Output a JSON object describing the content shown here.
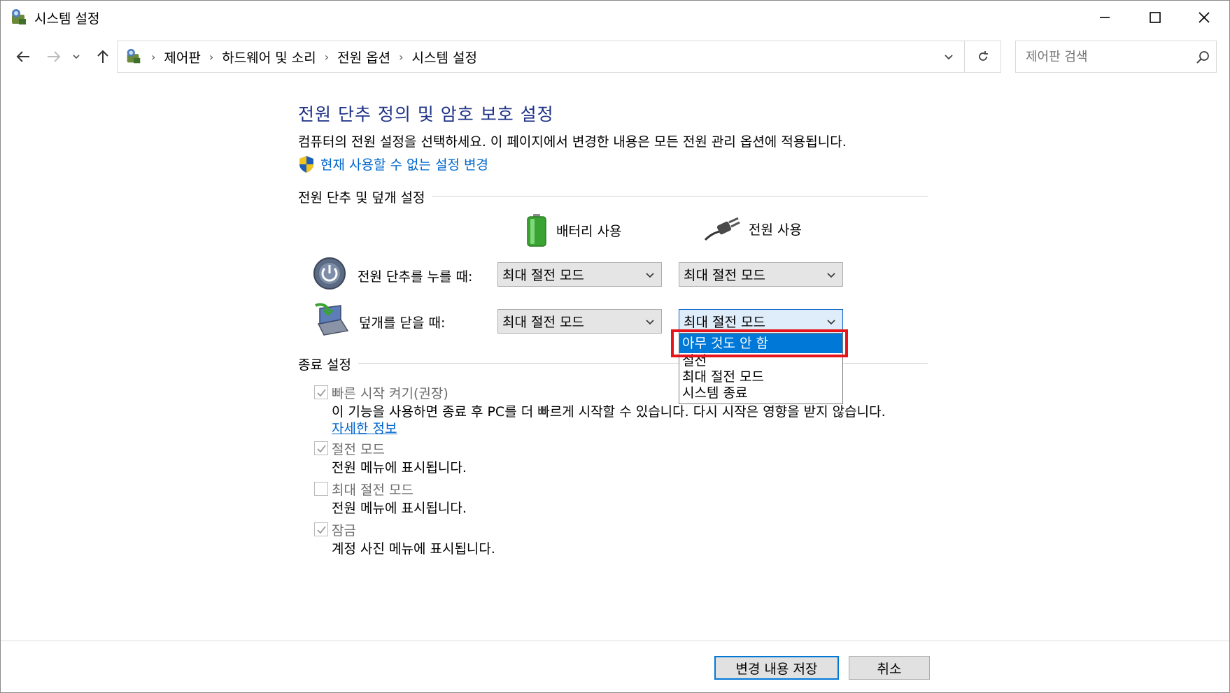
{
  "window": {
    "title": "시스템 설정",
    "controls": [
      "minimize",
      "maximize",
      "close"
    ]
  },
  "address": {
    "breadcrumbs": [
      "제어판",
      "하드웨어 및 소리",
      "전원 옵션",
      "시스템 설정"
    ],
    "search_placeholder": "제어판 검색"
  },
  "page": {
    "heading": "전원 단추 정의 및 암호 보호 설정",
    "description": "컴퓨터의 전원 설정을 선택하세요. 이 페이지에서 변경한 내용은 모든 전원 관리 옵션에 적용됩니다.",
    "admin_link": "현재 사용할 수 없는 설정 변경"
  },
  "power_section": {
    "title": "전원 단추 및 덮개 설정",
    "columns": {
      "battery": "배터리 사용",
      "plugged": "전원 사용"
    },
    "rows": [
      {
        "label": "전원 단추를 누를 때:",
        "battery_value": "최대 절전 모드",
        "plugged_value": "최대 절전 모드"
      },
      {
        "label": "덮개를 닫을 때:",
        "battery_value": "최대 절전 모드",
        "plugged_value": "최대 절전 모드"
      }
    ],
    "dropdown_options": [
      "아무 것도 안 함",
      "절전",
      "최대 절전 모드",
      "시스템 종료"
    ],
    "dropdown_highlighted": "아무 것도 안 함"
  },
  "shutdown_section": {
    "title": "종료 설정",
    "items": [
      {
        "label": "빠른 시작 켜기(권장)",
        "checked": true,
        "desc": "이 기능을 사용하면 종료 후 PC를 더 빠르게 시작할 수 있습니다. 다시 시작은 영향을 받지 않습니다.",
        "link": "자세한 정보"
      },
      {
        "label": "절전 모드",
        "checked": true,
        "desc": "전원 메뉴에 표시됩니다."
      },
      {
        "label": "최대 절전 모드",
        "checked": false,
        "desc": "전원 메뉴에 표시됩니다."
      },
      {
        "label": "잠금",
        "checked": true,
        "desc": "계정 사진 메뉴에 표시됩니다."
      }
    ]
  },
  "footer": {
    "save_label": "변경 내용 저장",
    "cancel_label": "취소"
  },
  "colors": {
    "heading": "#1e3287",
    "link": "#0066cc",
    "selection": "#0078d7",
    "highlight_box": "#e8141b"
  }
}
